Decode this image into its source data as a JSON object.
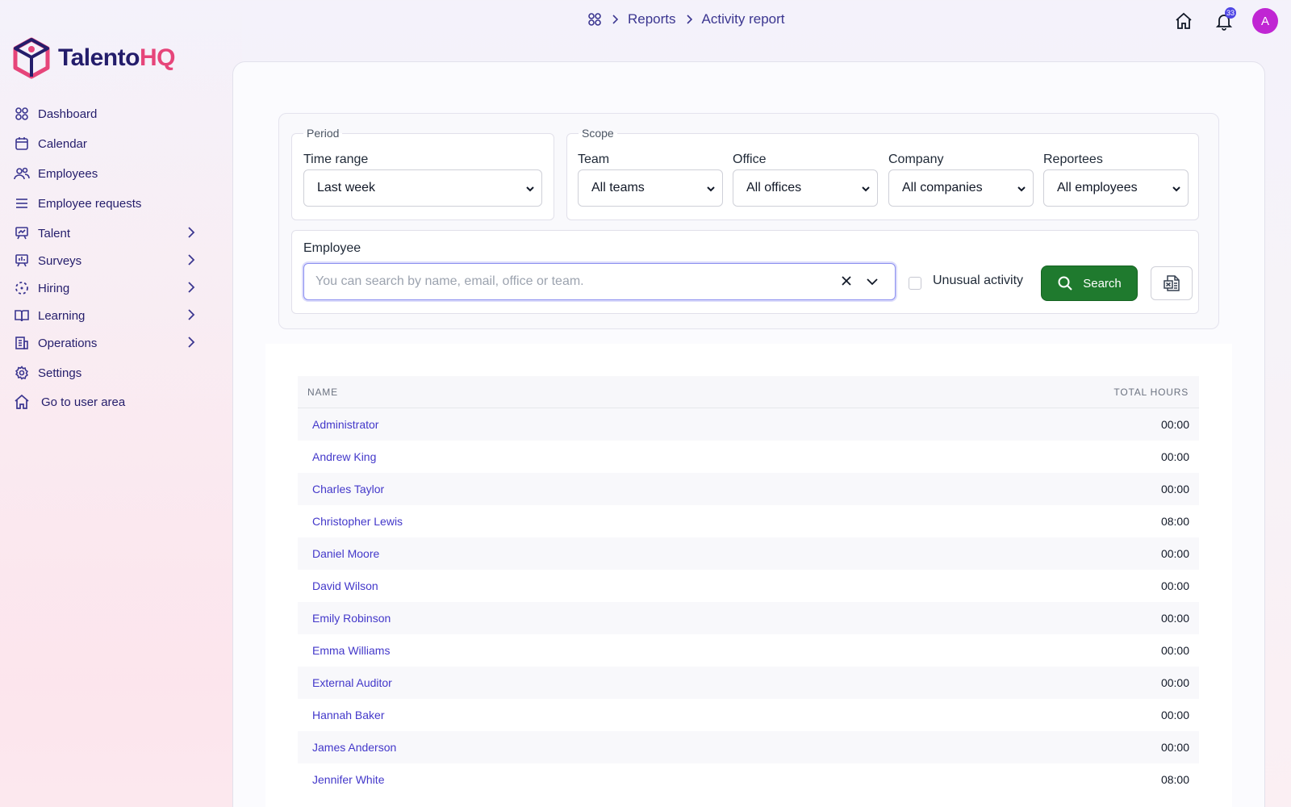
{
  "breadcrumb": {
    "items": [
      "Reports",
      "Activity report"
    ]
  },
  "topbar": {
    "notification_count": "33",
    "avatar_initial": "A"
  },
  "logo": {
    "part1": "Talento",
    "part2": "HQ"
  },
  "sidebar": {
    "items": [
      {
        "label": "Dashboard",
        "icon": "grid-icon",
        "expandable": false
      },
      {
        "label": "Calendar",
        "icon": "calendar-icon",
        "expandable": false
      },
      {
        "label": "Employees",
        "icon": "users-icon",
        "expandable": false
      },
      {
        "label": "Employee requests",
        "icon": "list-icon",
        "expandable": false
      },
      {
        "label": "Talent",
        "icon": "presentation-icon",
        "expandable": true
      },
      {
        "label": "Surveys",
        "icon": "chart-board-icon",
        "expandable": true
      },
      {
        "label": "Hiring",
        "icon": "dotted-circle-icon",
        "expandable": true
      },
      {
        "label": "Learning",
        "icon": "book-icon",
        "expandable": true
      },
      {
        "label": "Operations",
        "icon": "building-icon",
        "expandable": true
      },
      {
        "label": "Settings",
        "icon": "gear-icon",
        "expandable": false
      },
      {
        "label": "Go to user area",
        "icon": "home-icon",
        "expandable": false
      }
    ]
  },
  "filters": {
    "period_legend": "Period",
    "scope_legend": "Scope",
    "time_range": {
      "label": "Time range",
      "value": "Last week"
    },
    "team": {
      "label": "Team",
      "value": "All teams"
    },
    "office": {
      "label": "Office",
      "value": "All offices"
    },
    "company": {
      "label": "Company",
      "value": "All companies"
    },
    "reportees": {
      "label": "Reportees",
      "value": "All employees"
    },
    "employee": {
      "label": "Employee",
      "placeholder": "You can search by name, email, office or team."
    },
    "unusual_activity_label": "Unusual activity",
    "search_label": "Search"
  },
  "table": {
    "columns": [
      "NAME",
      "TOTAL HOURS"
    ],
    "rows": [
      {
        "name": "Administrator",
        "hours": "00:00"
      },
      {
        "name": "Andrew King",
        "hours": "00:00"
      },
      {
        "name": "Charles Taylor",
        "hours": "00:00"
      },
      {
        "name": "Christopher Lewis",
        "hours": "08:00"
      },
      {
        "name": "Daniel Moore",
        "hours": "00:00"
      },
      {
        "name": "David Wilson",
        "hours": "00:00"
      },
      {
        "name": "Emily Robinson",
        "hours": "00:00"
      },
      {
        "name": "Emma Williams",
        "hours": "00:00"
      },
      {
        "name": "External Auditor",
        "hours": "00:00"
      },
      {
        "name": "Hannah Baker",
        "hours": "00:00"
      },
      {
        "name": "James Anderson",
        "hours": "00:00"
      },
      {
        "name": "Jennifer White",
        "hours": "08:00"
      }
    ]
  },
  "colors": {
    "brand_navy": "#241d6b",
    "brand_pink": "#e6457a",
    "link": "#4338ca",
    "search_button": "#1f7a2e"
  }
}
